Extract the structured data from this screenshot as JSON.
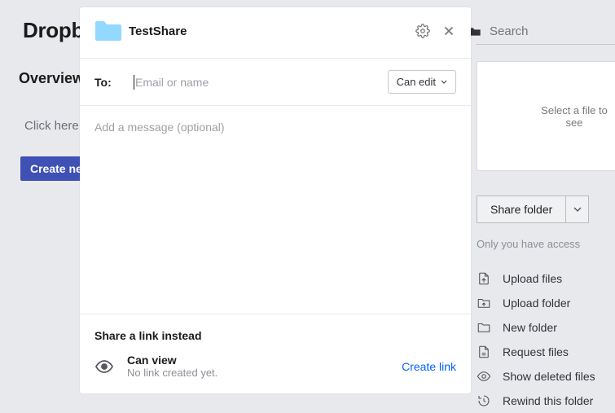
{
  "background": {
    "brand": "Dropbo",
    "overview": "Overview",
    "click_hint": "Click here t",
    "create_btn": "Create new",
    "search_placeholder": "Search",
    "preview_text": "Select a file to see",
    "share_btn": "Share folder",
    "access_text": "Only you have access",
    "actions": {
      "upload_files": "Upload files",
      "upload_folder": "Upload folder",
      "new_folder": "New folder",
      "request_files": "Request files",
      "show_deleted": "Show deleted files",
      "rewind": "Rewind this folder"
    }
  },
  "modal": {
    "title": "TestShare",
    "to_label": "To:",
    "to_placeholder": "Email or name",
    "permission_label": "Can edit",
    "message_placeholder": "Add a message (optional)",
    "link_section_title": "Share a link instead",
    "link_perm_title": "Can view",
    "link_perm_sub": "No link created yet.",
    "create_link": "Create link"
  }
}
